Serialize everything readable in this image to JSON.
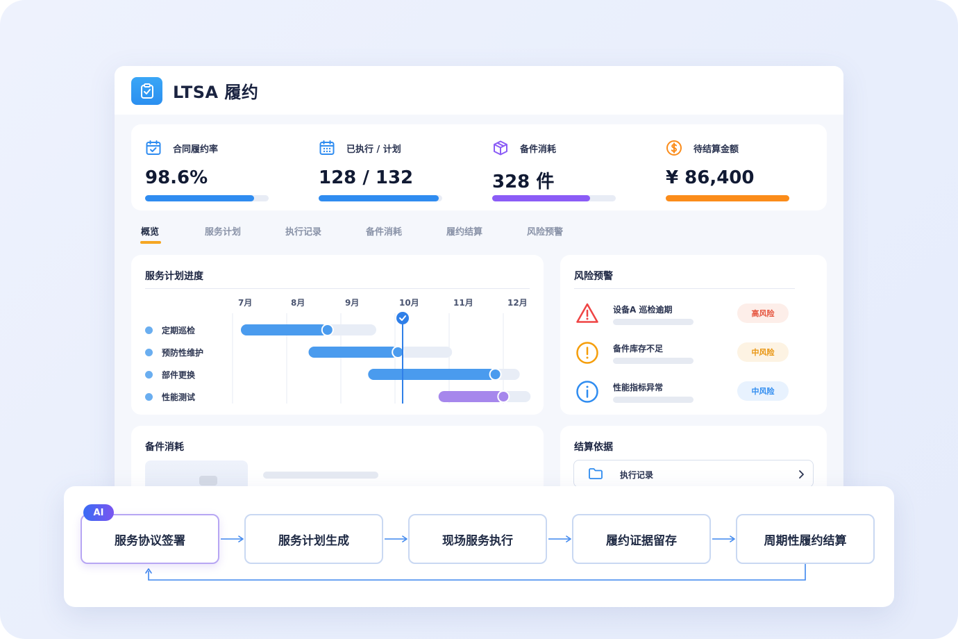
{
  "app": {
    "title": "LTSA 履约",
    "icon": "clipboard-check-icon"
  },
  "kpis": [
    {
      "label": "合同履约率",
      "value": "98.6%",
      "progress": 0.88,
      "color": "#2f8cf0",
      "icon": "calendar-check-icon"
    },
    {
      "label": "已执行 / 计划",
      "value": "128 / 132",
      "progress": 0.97,
      "color": "#2f8cf0",
      "icon": "calendar-grid-icon"
    },
    {
      "label": "备件消耗",
      "value": "328 件",
      "progress": 0.79,
      "color": "#8b5cf6",
      "icon": "package-icon"
    },
    {
      "label": "待结算金额",
      "value": "¥ 86,400",
      "progress": 1.0,
      "color": "#fb8c1a",
      "icon": "dollar-coin-icon"
    }
  ],
  "tabs": [
    "概览",
    "服务计划",
    "执行记录",
    "备件消耗",
    "履约结算",
    "风险预警"
  ],
  "schedule": {
    "title": "服务计划进度",
    "months": [
      "7月",
      "8月",
      "9月",
      "10月",
      "11月",
      "12月"
    ],
    "current_month_index": 3,
    "rows": [
      {
        "label": "定期巡检",
        "start": 0.0,
        "end": 2.5,
        "progress": 1.6,
        "color": "#4a9bee"
      },
      {
        "label": "预防性维护",
        "start": 1.25,
        "end": 3.9,
        "progress": 2.9,
        "color": "#4a9bee"
      },
      {
        "label": "部件更换",
        "start": 2.35,
        "end": 5.15,
        "progress": 4.7,
        "color": "#4a9bee"
      },
      {
        "label": "性能测试",
        "start": 3.65,
        "end": 5.35,
        "progress": 4.85,
        "color": "#a687ec"
      }
    ]
  },
  "risks": {
    "title": "风险预警",
    "items": [
      {
        "text": "设备A 巡检逾期",
        "badge": "高风险",
        "icon": "warning-triangle-icon",
        "color": "#ef4444",
        "badge_bg": "#fdeee9",
        "badge_fg": "#e5533d"
      },
      {
        "text": "备件库存不足",
        "badge": "中风险",
        "icon": "exclamation-circle-icon",
        "color": "#f59e0b",
        "badge_bg": "#fdf3e3",
        "badge_fg": "#e8940f"
      },
      {
        "text": "性能指标异常",
        "badge": "中风险",
        "icon": "info-circle-icon",
        "color": "#2f8cf0",
        "badge_bg": "#e8f2fe",
        "badge_fg": "#2f8cf0"
      }
    ]
  },
  "parts": {
    "title": "备件消耗"
  },
  "settlement": {
    "title": "结算依据",
    "item_label": "执行记录",
    "item_icon": "folder-icon",
    "chevron": "chevron-right-icon"
  },
  "flow": {
    "ai_badge": "AI",
    "steps": [
      "服务协议签署",
      "服务计划生成",
      "现场服务执行",
      "履约证据留存",
      "周期性履约结算"
    ]
  }
}
